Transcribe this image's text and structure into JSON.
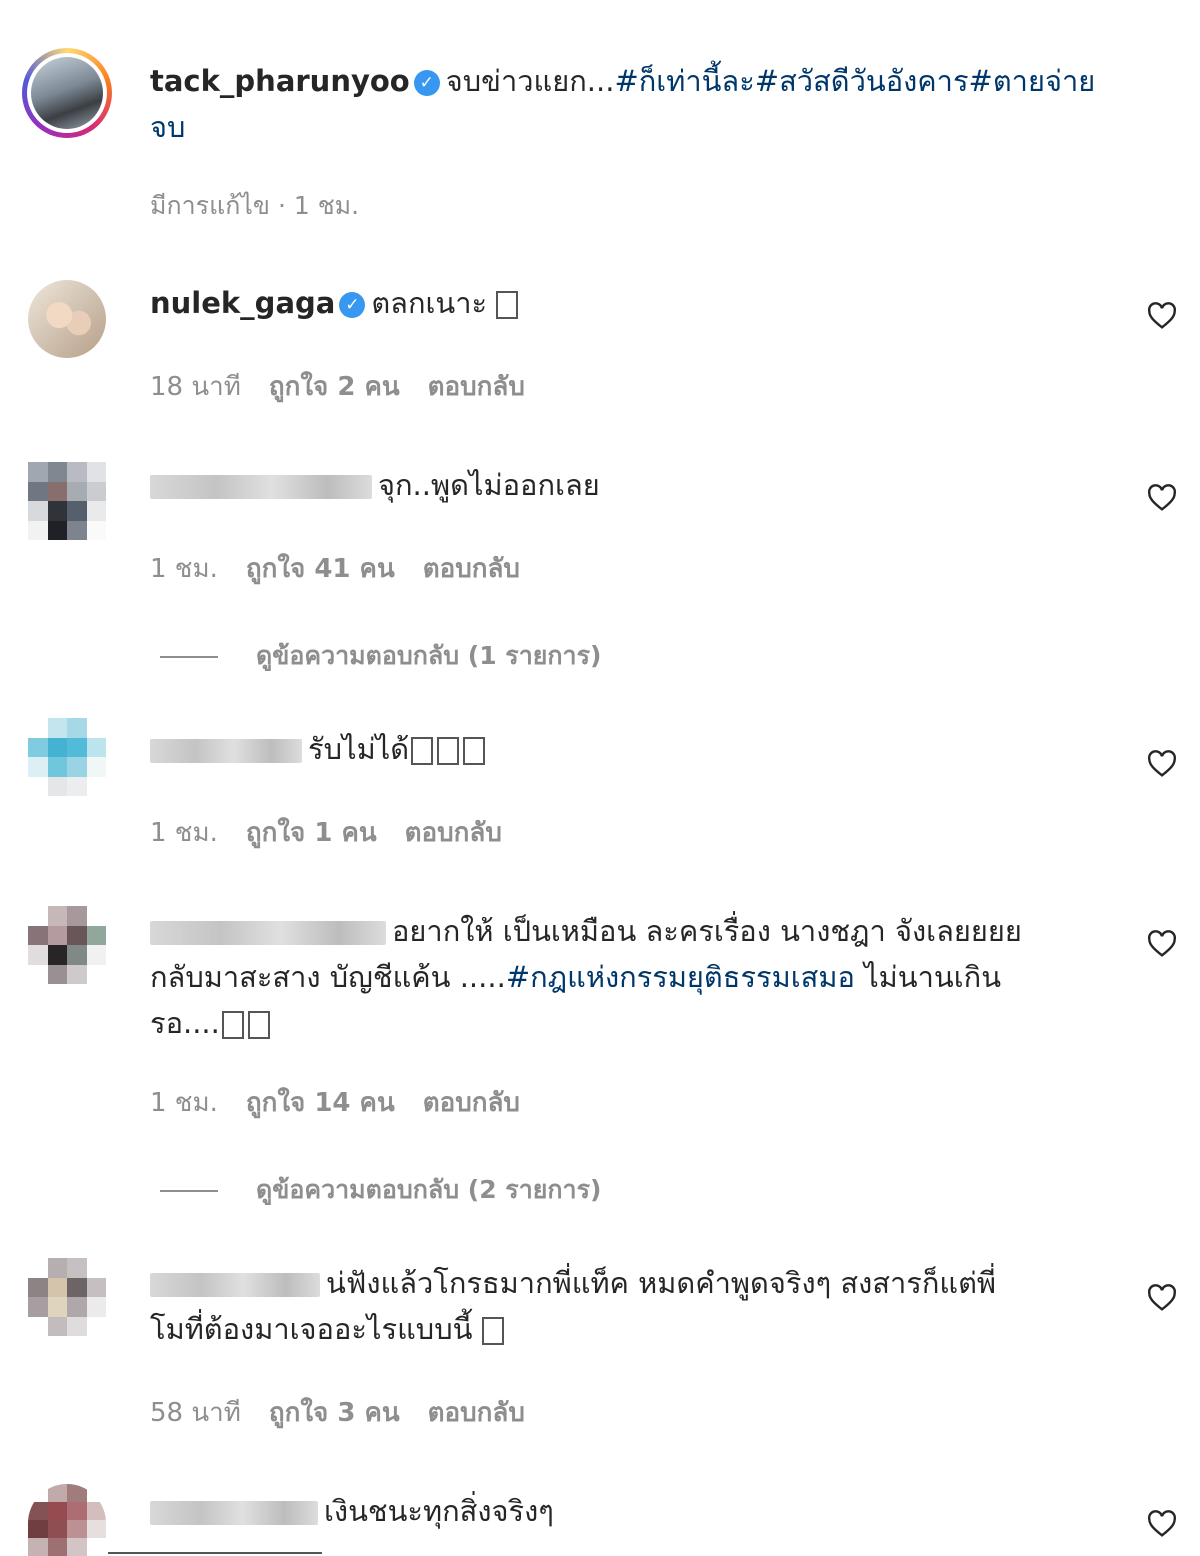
{
  "post": {
    "username": "tack_pharunyoo",
    "caption_line1": "จบข่าวแยก...",
    "hashtags_line1": "#ก็เท่านี้ละ#สวัสดีวันอังคาร#ตายจ่าย",
    "caption_line2": "จบ",
    "meta": "มีการแก้ไข · 1 ชม."
  },
  "comments": [
    {
      "username": "nulek_gaga",
      "verified": true,
      "text": "ตลกเนาะ ",
      "time": "18 นาที",
      "likes": "ถูกใจ 2 คน",
      "reply": "ตอบกลับ"
    },
    {
      "username": "",
      "text": "จุก..พูดไม่ออกเลย",
      "time": "1 ชม.",
      "likes": "ถูกใจ 41 คน",
      "reply": "ตอบกลับ",
      "view_replies": "ดูข้อความตอบกลับ (1 รายการ)"
    },
    {
      "username": "",
      "text": "รับไม่ได้",
      "time": "1 ชม.",
      "likes": "ถูกใจ 1 คน",
      "reply": "ตอบกลับ"
    },
    {
      "username": "",
      "text_line1": "อยากให้ เป็นเหมือน ละครเรื่อง นางชฎา จังเลยยยย",
      "text_line2_pre": "กลับมาสะสาง บัญชีแค้น .....",
      "text_line2_tag": "#กฎแห่งกรรมยุติธรรมเสมอ",
      "text_line2_post": " ไม่นานเกิน",
      "text_line3": "รอ....",
      "time": "1 ชม.",
      "likes": "ถูกใจ 14 คน",
      "reply": "ตอบกลับ",
      "view_replies": "ดูข้อความตอบกลับ (2 รายการ)"
    },
    {
      "username": "",
      "text_line1": "น่ฟังแล้วโกรธมากพี่แท็ค หมดคำพูดจริงๆ สงสารก็แต่พี่",
      "text_line2": "โมที่ต้องมาเจออะไรแบบนี้ ",
      "time": "58 นาที",
      "likes": "ถูกใจ 3 คน",
      "reply": "ตอบกลับ"
    },
    {
      "username": "",
      "text": "เงินชนะทุกสิ่งจริงๆ"
    }
  ],
  "icons": {
    "verified": "verified-badge-icon",
    "heart": "heart-outline-icon"
  },
  "colors": {
    "hashtag": "#00376b",
    "verified": "#3897f0",
    "meta": "#8e8e8e"
  }
}
